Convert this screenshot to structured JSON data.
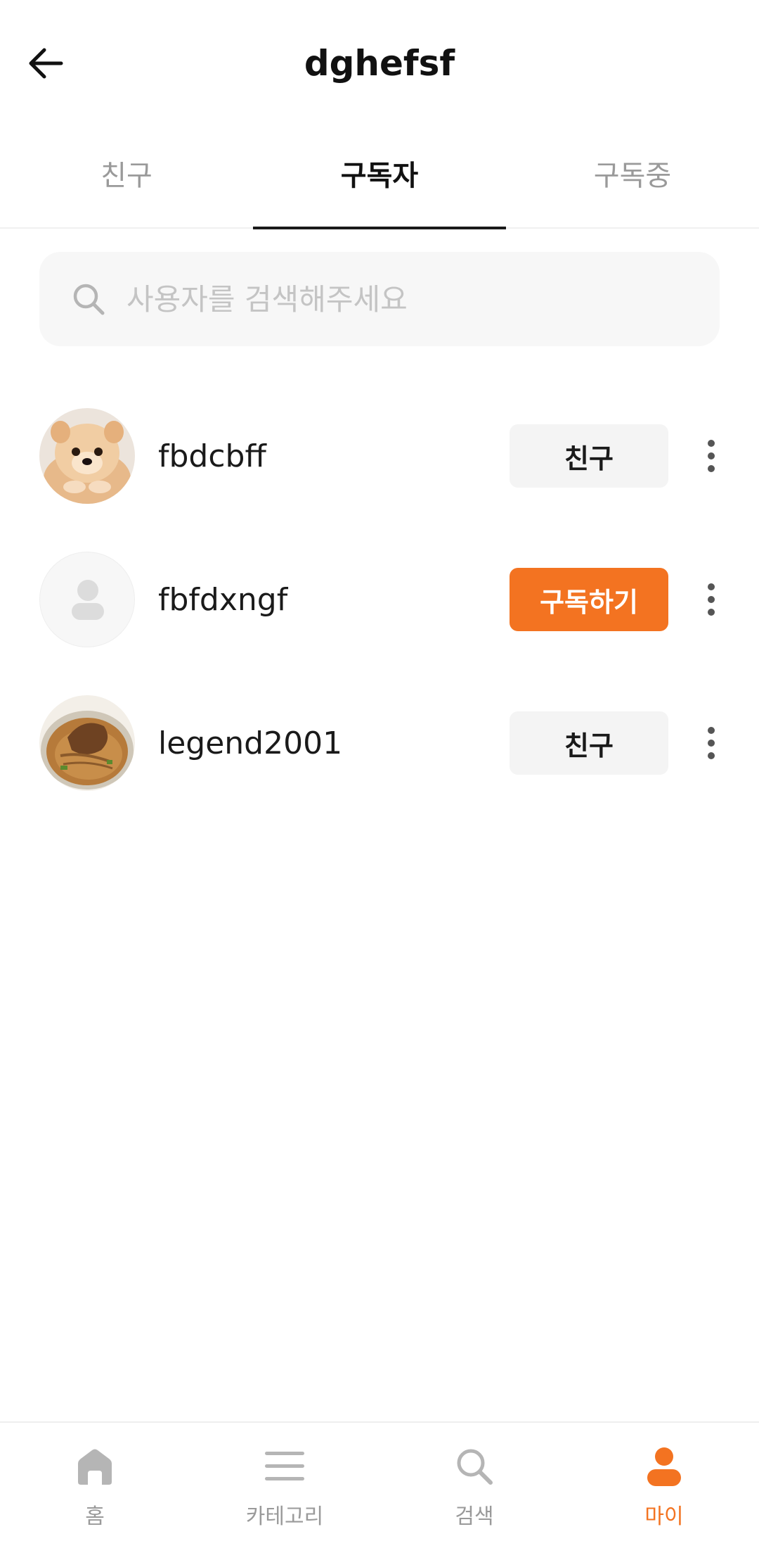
{
  "header": {
    "title": "dghefsf",
    "back_icon": "arrow-left-icon"
  },
  "tabs": [
    {
      "label": "친구",
      "active": false
    },
    {
      "label": "구독자",
      "active": true
    },
    {
      "label": "구독중",
      "active": false
    }
  ],
  "search": {
    "placeholder": "사용자를 검색해주세요",
    "value": ""
  },
  "users": [
    {
      "username": "fbdcbff",
      "avatar": "pomeranian-photo",
      "action_label": "친구",
      "action_type": "friend"
    },
    {
      "username": "fbfdxngf",
      "avatar": "default-avatar",
      "action_label": "구독하기",
      "action_type": "subscribe"
    },
    {
      "username": "legend2001",
      "avatar": "food-photo",
      "action_label": "친구",
      "action_type": "friend"
    }
  ],
  "bottom_nav": [
    {
      "label": "홈",
      "icon": "home-icon",
      "active": false
    },
    {
      "label": "카테고리",
      "icon": "menu-icon",
      "active": false
    },
    {
      "label": "검색",
      "icon": "search-icon",
      "active": false
    },
    {
      "label": "마이",
      "icon": "user-icon",
      "active": true
    }
  ],
  "colors": {
    "accent": "#f37321",
    "inactive": "#9a9a9a",
    "text": "#1a1a1a"
  }
}
